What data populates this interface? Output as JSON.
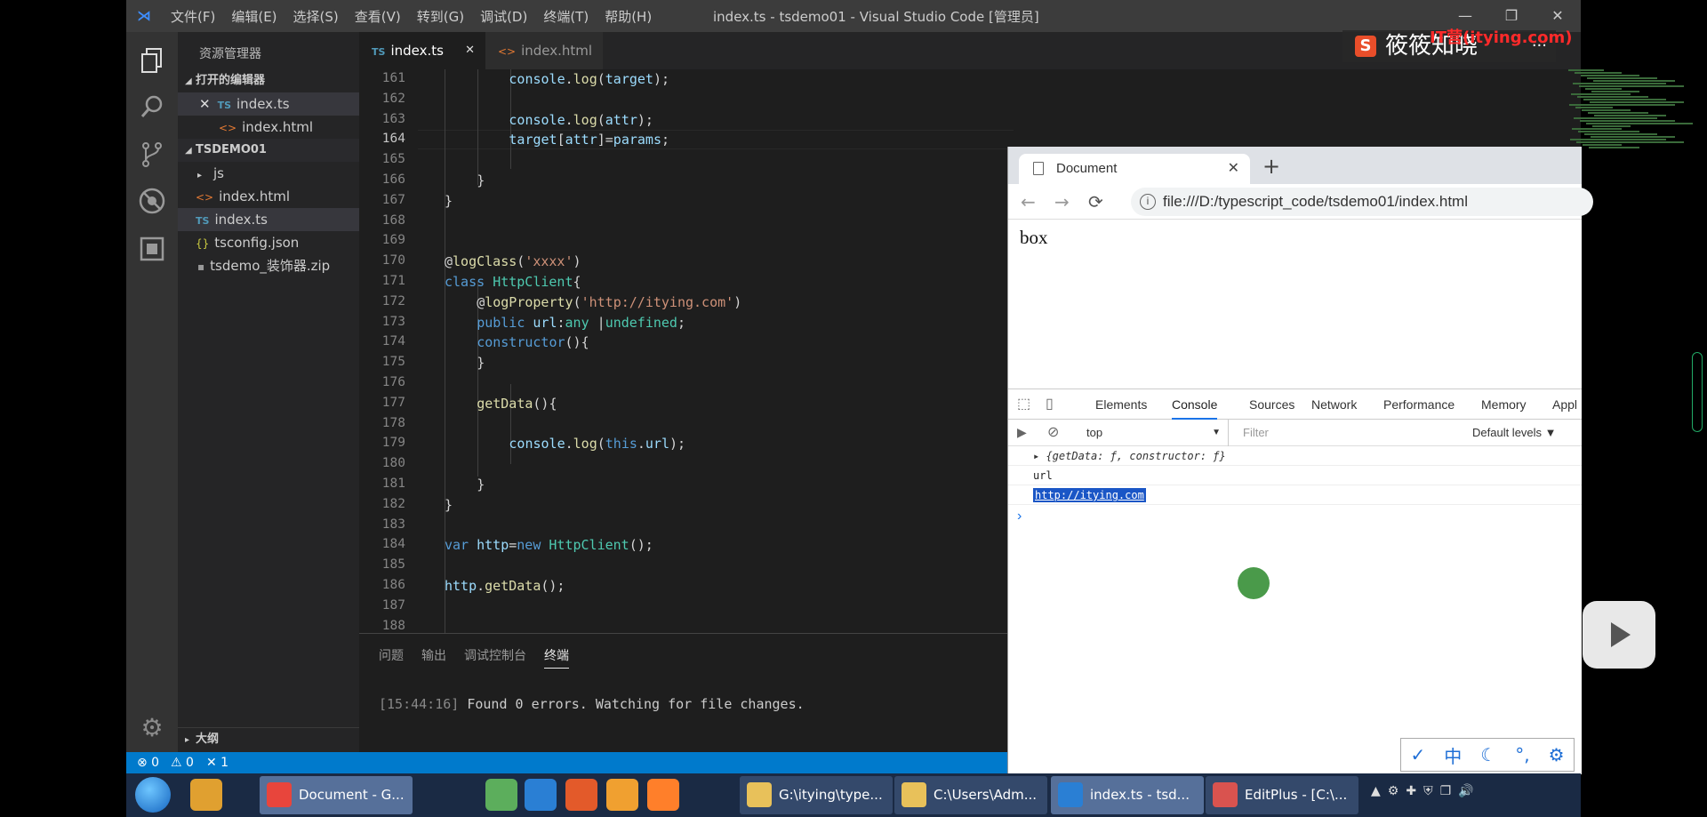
{
  "window": {
    "title": "index.ts - tsdemo01 - Visual Studio Code [管理员]",
    "menu": [
      "文件(F)",
      "编辑(E)",
      "选择(S)",
      "查看(V)",
      "转到(G)",
      "调试(D)",
      "终端(T)",
      "帮助(H)"
    ],
    "controls": [
      "—",
      "❐",
      "✕"
    ]
  },
  "watermark": {
    "brand": "筱筱知晓",
    "red_text": "IT营(itying.com)",
    "more": "···"
  },
  "activity_bar": {
    "icons": [
      "explorer-icon",
      "search-icon",
      "source-control-icon",
      "debug-icon",
      "extensions-icon"
    ],
    "bottom_icon": "settings-icon"
  },
  "sidebar": {
    "title": "资源管理器",
    "open_editors_label": "打开的编辑器",
    "open_editors": [
      {
        "badge": "TS",
        "name": "index.ts",
        "close": "✕"
      },
      {
        "badge": "<>",
        "name": "index.html"
      }
    ],
    "project_label": "TSDEMO01",
    "files": [
      {
        "type": "folder",
        "name": "js"
      },
      {
        "type": "html",
        "badge": "<>",
        "name": "index.html"
      },
      {
        "type": "ts",
        "badge": "TS",
        "name": "index.ts"
      },
      {
        "type": "json",
        "badge": "{}",
        "name": "tsconfig.json"
      },
      {
        "type": "zip",
        "badge": "▪",
        "name": "tsdemo_装饰器.zip"
      }
    ],
    "outline_label": "大纲"
  },
  "tabs": [
    {
      "badge": "TS",
      "name": "index.ts",
      "close": "✕",
      "active": true
    },
    {
      "badge": "<>",
      "name": "index.html",
      "active": false
    }
  ],
  "editor": {
    "current_line": 164,
    "lines": [
      {
        "n": 161,
        "indent": 3,
        "tokens": [
          [
            "v",
            "console"
          ],
          [
            "p",
            "."
          ],
          [
            "f",
            "log"
          ],
          [
            "p",
            "("
          ],
          [
            "v",
            "target"
          ],
          [
            "p",
            ");"
          ]
        ]
      },
      {
        "n": 162,
        "indent": 0,
        "tokens": []
      },
      {
        "n": 163,
        "indent": 3,
        "tokens": [
          [
            "v",
            "console"
          ],
          [
            "p",
            "."
          ],
          [
            "f",
            "log"
          ],
          [
            "p",
            "("
          ],
          [
            "v",
            "attr"
          ],
          [
            "p",
            ");"
          ]
        ]
      },
      {
        "n": 164,
        "indent": 3,
        "tokens": [
          [
            "v",
            "target"
          ],
          [
            "p",
            "["
          ],
          [
            "v",
            "attr"
          ],
          [
            "p",
            "]="
          ],
          [
            "v",
            "params"
          ],
          [
            "p",
            ";"
          ]
        ]
      },
      {
        "n": 165,
        "indent": 0,
        "tokens": []
      },
      {
        "n": 166,
        "indent": 2,
        "tokens": [
          [
            "p",
            "}"
          ]
        ]
      },
      {
        "n": 167,
        "indent": 1,
        "tokens": [
          [
            "p",
            "}"
          ]
        ]
      },
      {
        "n": 168,
        "indent": 0,
        "tokens": []
      },
      {
        "n": 169,
        "indent": 0,
        "tokens": []
      },
      {
        "n": 170,
        "indent": 1,
        "tokens": [
          [
            "p",
            "@"
          ],
          [
            "f",
            "logClass"
          ],
          [
            "p",
            "("
          ],
          [
            "s",
            "'xxxx'"
          ],
          [
            "p",
            ")"
          ]
        ]
      },
      {
        "n": 171,
        "indent": 1,
        "tokens": [
          [
            "k",
            "class "
          ],
          [
            "c",
            "HttpClient"
          ],
          [
            "p",
            "{"
          ]
        ]
      },
      {
        "n": 172,
        "indent": 2,
        "tokens": [
          [
            "p",
            "@"
          ],
          [
            "f",
            "logProperty"
          ],
          [
            "p",
            "("
          ],
          [
            "s",
            "'http://itying.com'"
          ],
          [
            "p",
            ")"
          ]
        ]
      },
      {
        "n": 173,
        "indent": 2,
        "tokens": [
          [
            "k",
            "public "
          ],
          [
            "v",
            "url"
          ],
          [
            "p",
            ":"
          ],
          [
            "c",
            "any"
          ],
          [
            "p",
            " |"
          ],
          [
            "c",
            "undefined"
          ],
          [
            "p",
            ";"
          ]
        ]
      },
      {
        "n": 174,
        "indent": 2,
        "tokens": [
          [
            "k",
            "constructor"
          ],
          [
            "p",
            "(){"
          ]
        ]
      },
      {
        "n": 175,
        "indent": 2,
        "tokens": [
          [
            "p",
            "}"
          ]
        ]
      },
      {
        "n": 176,
        "indent": 0,
        "tokens": []
      },
      {
        "n": 177,
        "indent": 2,
        "tokens": [
          [
            "f",
            "getData"
          ],
          [
            "p",
            "(){"
          ]
        ]
      },
      {
        "n": 178,
        "indent": 0,
        "tokens": []
      },
      {
        "n": 179,
        "indent": 3,
        "tokens": [
          [
            "v",
            "console"
          ],
          [
            "p",
            "."
          ],
          [
            "f",
            "log"
          ],
          [
            "p",
            "("
          ],
          [
            "k",
            "this"
          ],
          [
            "p",
            "."
          ],
          [
            "v",
            "url"
          ],
          [
            "p",
            ");"
          ]
        ]
      },
      {
        "n": 180,
        "indent": 0,
        "tokens": []
      },
      {
        "n": 181,
        "indent": 2,
        "tokens": [
          [
            "p",
            "}"
          ]
        ]
      },
      {
        "n": 182,
        "indent": 1,
        "tokens": [
          [
            "p",
            "}"
          ]
        ]
      },
      {
        "n": 183,
        "indent": 0,
        "tokens": []
      },
      {
        "n": 184,
        "indent": 1,
        "tokens": [
          [
            "k",
            "var "
          ],
          [
            "v",
            "http"
          ],
          [
            "p",
            "="
          ],
          [
            "k",
            "new "
          ],
          [
            "c",
            "HttpClient"
          ],
          [
            "p",
            "();"
          ]
        ]
      },
      {
        "n": 185,
        "indent": 0,
        "tokens": []
      },
      {
        "n": 186,
        "indent": 1,
        "tokens": [
          [
            "v",
            "http"
          ],
          [
            "p",
            "."
          ],
          [
            "f",
            "getData"
          ],
          [
            "p",
            "();"
          ]
        ]
      },
      {
        "n": 187,
        "indent": 0,
        "tokens": []
      },
      {
        "n": 188,
        "indent": 0,
        "tokens": []
      }
    ]
  },
  "panel": {
    "tabs": [
      "问题",
      "输出",
      "调试控制台",
      "终端"
    ],
    "active_tab": "终端",
    "terminal_time": "[15:44:16]",
    "terminal_msg": " Found 0 errors. Watching for file changes."
  },
  "statusbar": {
    "errors": "⊗ 0",
    "warnings": "⚠ 0",
    "sync": "✕ 1"
  },
  "chrome": {
    "tab_title": "Document",
    "tab_close": "✕",
    "new_tab": "+",
    "nav": [
      "←",
      "→",
      "⟳"
    ],
    "info_icon": "i",
    "url": "file:///D:/typescript_code/tsdemo01/index.html",
    "page_text": "box"
  },
  "devtools": {
    "tabs": [
      "Elements",
      "Console",
      "Sources",
      "Network",
      "Performance",
      "Memory",
      "Appl"
    ],
    "active_tab": "Console",
    "context": "top",
    "filter_placeholder": "Filter",
    "levels": "Default levels ▼",
    "logs": [
      "▸ {getData: ƒ, constructor: ƒ}",
      "url",
      "http://itying.com"
    ],
    "prompt": "›"
  },
  "ime": [
    "✓",
    "中",
    "☾",
    "°,",
    "⚙"
  ],
  "taskbar": {
    "items": [
      {
        "label": "Document - G...",
        "color": "#e8453c",
        "active": true
      },
      {
        "label": "G:\\itying\\type...",
        "color": "#e8c15a",
        "active": false
      },
      {
        "label": "C:\\Users\\Adm...",
        "color": "#e8c15a",
        "active": false
      },
      {
        "label": "index.ts - tsd...",
        "color": "#2a7fd4",
        "active": true
      },
      {
        "label": "EditPlus - [C:\\...",
        "color": "#d9534f",
        "active": false
      }
    ],
    "pinned_colors": [
      "#e0a030",
      "#5cae5c",
      "#2a7fd4",
      "#e35a2a",
      "#f0a030",
      "#ff7f2a"
    ],
    "tray": [
      "▲",
      "⚙",
      "✚",
      "⛨",
      "❐",
      "🔊"
    ]
  }
}
